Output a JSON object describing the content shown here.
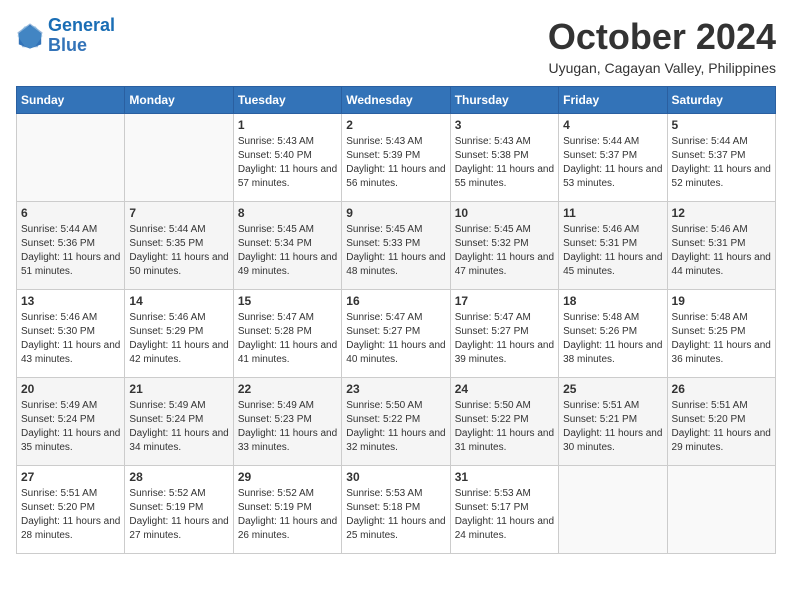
{
  "header": {
    "logo_line1": "General",
    "logo_line2": "Blue",
    "month": "October 2024",
    "location": "Uyugan, Cagayan Valley, Philippines"
  },
  "days_of_week": [
    "Sunday",
    "Monday",
    "Tuesday",
    "Wednesday",
    "Thursday",
    "Friday",
    "Saturday"
  ],
  "weeks": [
    [
      {
        "day": "",
        "content": ""
      },
      {
        "day": "",
        "content": ""
      },
      {
        "day": "1",
        "content": "Sunrise: 5:43 AM\nSunset: 5:40 PM\nDaylight: 11 hours and 57 minutes."
      },
      {
        "day": "2",
        "content": "Sunrise: 5:43 AM\nSunset: 5:39 PM\nDaylight: 11 hours and 56 minutes."
      },
      {
        "day": "3",
        "content": "Sunrise: 5:43 AM\nSunset: 5:38 PM\nDaylight: 11 hours and 55 minutes."
      },
      {
        "day": "4",
        "content": "Sunrise: 5:44 AM\nSunset: 5:37 PM\nDaylight: 11 hours and 53 minutes."
      },
      {
        "day": "5",
        "content": "Sunrise: 5:44 AM\nSunset: 5:37 PM\nDaylight: 11 hours and 52 minutes."
      }
    ],
    [
      {
        "day": "6",
        "content": "Sunrise: 5:44 AM\nSunset: 5:36 PM\nDaylight: 11 hours and 51 minutes."
      },
      {
        "day": "7",
        "content": "Sunrise: 5:44 AM\nSunset: 5:35 PM\nDaylight: 11 hours and 50 minutes."
      },
      {
        "day": "8",
        "content": "Sunrise: 5:45 AM\nSunset: 5:34 PM\nDaylight: 11 hours and 49 minutes."
      },
      {
        "day": "9",
        "content": "Sunrise: 5:45 AM\nSunset: 5:33 PM\nDaylight: 11 hours and 48 minutes."
      },
      {
        "day": "10",
        "content": "Sunrise: 5:45 AM\nSunset: 5:32 PM\nDaylight: 11 hours and 47 minutes."
      },
      {
        "day": "11",
        "content": "Sunrise: 5:46 AM\nSunset: 5:31 PM\nDaylight: 11 hours and 45 minutes."
      },
      {
        "day": "12",
        "content": "Sunrise: 5:46 AM\nSunset: 5:31 PM\nDaylight: 11 hours and 44 minutes."
      }
    ],
    [
      {
        "day": "13",
        "content": "Sunrise: 5:46 AM\nSunset: 5:30 PM\nDaylight: 11 hours and 43 minutes."
      },
      {
        "day": "14",
        "content": "Sunrise: 5:46 AM\nSunset: 5:29 PM\nDaylight: 11 hours and 42 minutes."
      },
      {
        "day": "15",
        "content": "Sunrise: 5:47 AM\nSunset: 5:28 PM\nDaylight: 11 hours and 41 minutes."
      },
      {
        "day": "16",
        "content": "Sunrise: 5:47 AM\nSunset: 5:27 PM\nDaylight: 11 hours and 40 minutes."
      },
      {
        "day": "17",
        "content": "Sunrise: 5:47 AM\nSunset: 5:27 PM\nDaylight: 11 hours and 39 minutes."
      },
      {
        "day": "18",
        "content": "Sunrise: 5:48 AM\nSunset: 5:26 PM\nDaylight: 11 hours and 38 minutes."
      },
      {
        "day": "19",
        "content": "Sunrise: 5:48 AM\nSunset: 5:25 PM\nDaylight: 11 hours and 36 minutes."
      }
    ],
    [
      {
        "day": "20",
        "content": "Sunrise: 5:49 AM\nSunset: 5:24 PM\nDaylight: 11 hours and 35 minutes."
      },
      {
        "day": "21",
        "content": "Sunrise: 5:49 AM\nSunset: 5:24 PM\nDaylight: 11 hours and 34 minutes."
      },
      {
        "day": "22",
        "content": "Sunrise: 5:49 AM\nSunset: 5:23 PM\nDaylight: 11 hours and 33 minutes."
      },
      {
        "day": "23",
        "content": "Sunrise: 5:50 AM\nSunset: 5:22 PM\nDaylight: 11 hours and 32 minutes."
      },
      {
        "day": "24",
        "content": "Sunrise: 5:50 AM\nSunset: 5:22 PM\nDaylight: 11 hours and 31 minutes."
      },
      {
        "day": "25",
        "content": "Sunrise: 5:51 AM\nSunset: 5:21 PM\nDaylight: 11 hours and 30 minutes."
      },
      {
        "day": "26",
        "content": "Sunrise: 5:51 AM\nSunset: 5:20 PM\nDaylight: 11 hours and 29 minutes."
      }
    ],
    [
      {
        "day": "27",
        "content": "Sunrise: 5:51 AM\nSunset: 5:20 PM\nDaylight: 11 hours and 28 minutes."
      },
      {
        "day": "28",
        "content": "Sunrise: 5:52 AM\nSunset: 5:19 PM\nDaylight: 11 hours and 27 minutes."
      },
      {
        "day": "29",
        "content": "Sunrise: 5:52 AM\nSunset: 5:19 PM\nDaylight: 11 hours and 26 minutes."
      },
      {
        "day": "30",
        "content": "Sunrise: 5:53 AM\nSunset: 5:18 PM\nDaylight: 11 hours and 25 minutes."
      },
      {
        "day": "31",
        "content": "Sunrise: 5:53 AM\nSunset: 5:17 PM\nDaylight: 11 hours and 24 minutes."
      },
      {
        "day": "",
        "content": ""
      },
      {
        "day": "",
        "content": ""
      }
    ]
  ]
}
